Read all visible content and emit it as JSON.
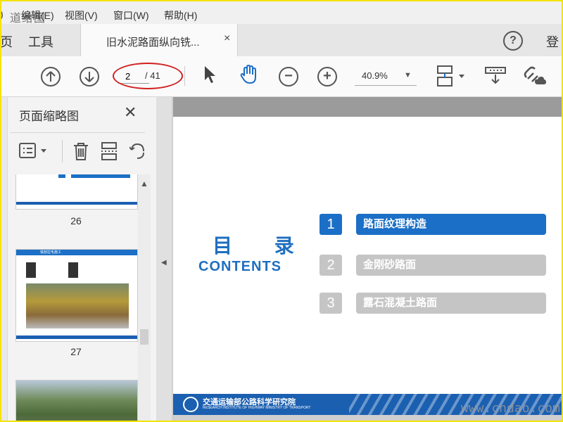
{
  "menubar": {
    "watermark": "道给图",
    "items": [
      ")",
      "编辑(E)",
      "视图(V)",
      "窗口(W)",
      "帮助(H)"
    ]
  },
  "tabbar": {
    "edge_label": "页",
    "tools_label": "工具",
    "doc_tab_title": "旧水泥路面纵向铣...",
    "close_glyph": "×",
    "help_glyph": "?",
    "login_label": "登"
  },
  "toolbar": {
    "current_page": "2",
    "total_pages": "/ 41",
    "zoom": "40.9%",
    "zoom_caret": "▼"
  },
  "thumbnails": {
    "title": "页面缩略图",
    "close_glyph": "✕",
    "pages": [
      {
        "label": "26"
      },
      {
        "label": "27",
        "heading": "铣刨拉毛施工"
      },
      {
        "label": ""
      }
    ]
  },
  "document": {
    "mulu": "目 录",
    "contents": "CONTENTS",
    "items": [
      {
        "num": "1",
        "label": "路面纹理构造",
        "state": "active"
      },
      {
        "num": "2",
        "label": "金刚砂路面",
        "state": "inactive"
      },
      {
        "num": "3",
        "label": "露石混凝土路面",
        "state": "inactive"
      }
    ],
    "footer_org": "交通运输部公路科学研究院",
    "footer_org_en": "RESEARCH INSTITUTE OF HIGHWAY MINISTRY OF TRANSPORT"
  },
  "watermark_bottom": "www.cndao.com",
  "colors": {
    "accent_blue": "#1b6fc6",
    "inactive_gray": "#c5c5c5",
    "annotation_red": "#d21f1f"
  }
}
